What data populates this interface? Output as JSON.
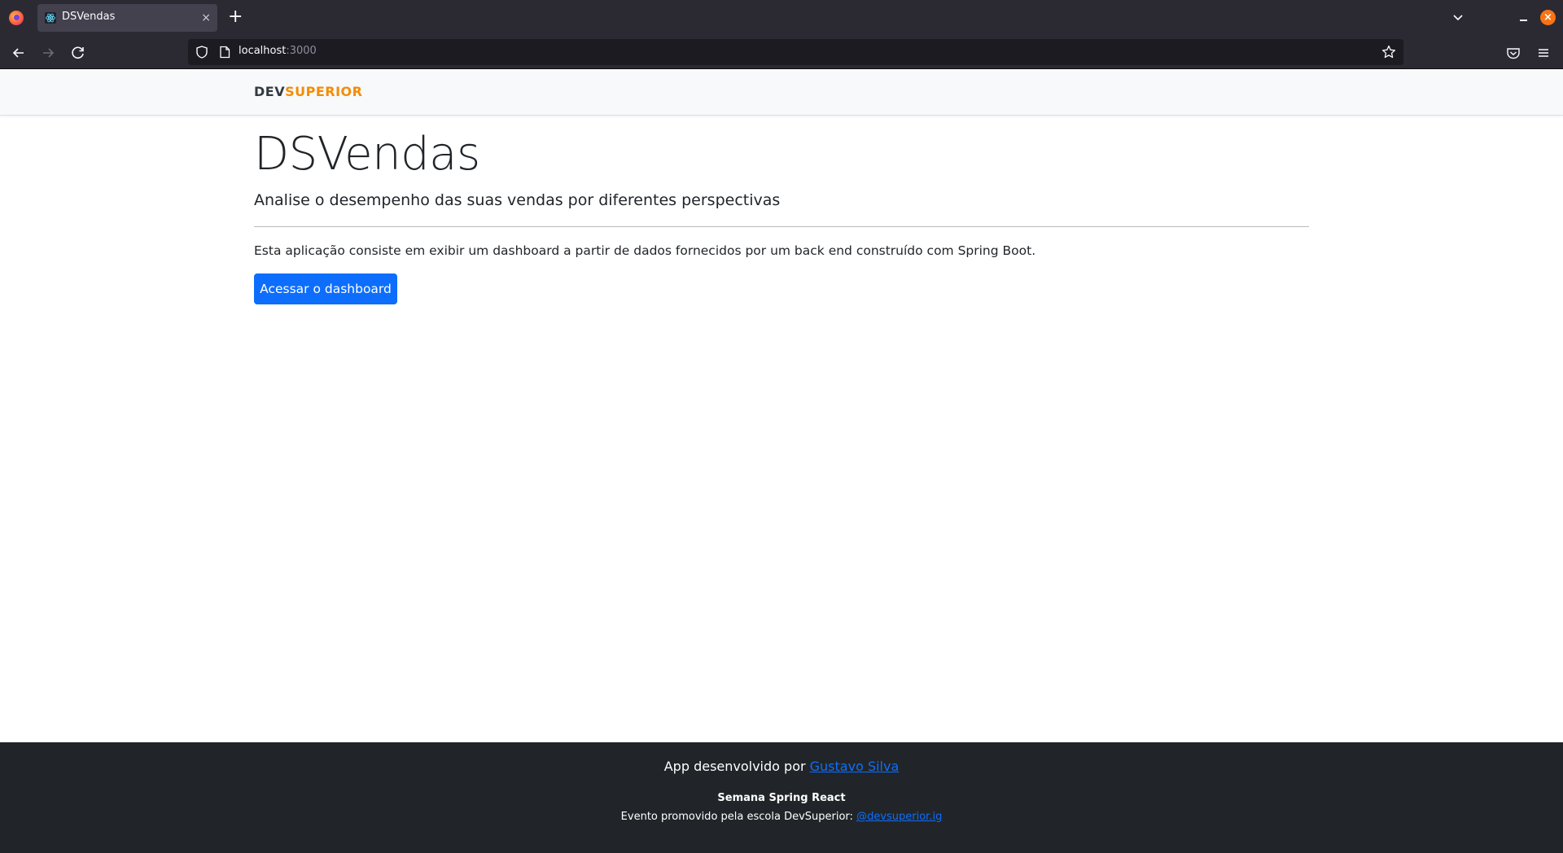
{
  "browser": {
    "tab_title": "DSVendas",
    "tab_close": "×",
    "new_tab": "+",
    "url_host": "localhost",
    "url_port": ":3000"
  },
  "header": {
    "logo_dev": "DEV",
    "logo_superior": "SUPERIOR"
  },
  "main": {
    "title": "DSVendas",
    "lead": "Analise o desempenho das suas vendas por diferentes perspectivas",
    "description": "Esta aplicação consiste em exibir um dashboard a partir de dados fornecidos por um back end construído com Spring Boot.",
    "cta_label": "Acessar o dashboard"
  },
  "footer": {
    "credit_prefix": "App desenvolvido por ",
    "credit_link": "Gustavo Silva",
    "event_title": "Semana Spring React",
    "event_prefix": "Evento promovido pela escola DevSuperior: ",
    "event_link": "@devsuperior.ig"
  },
  "colors": {
    "brand_orange": "#f48c06",
    "primary_blue": "#0d6efd",
    "footer_bg": "#212529",
    "header_bg": "#f8f9fa"
  }
}
